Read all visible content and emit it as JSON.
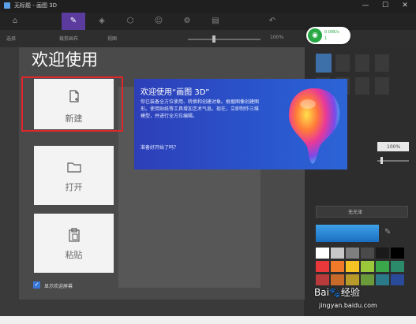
{
  "window": {
    "title": "无标题 - 画图 3D",
    "minimize": "—",
    "maximize": "☐",
    "close": "✕"
  },
  "toolbar": {
    "tools": [
      "⌂",
      "✎",
      "◈",
      "⬡",
      "☺",
      "⚙",
      "▤",
      "↶"
    ]
  },
  "subbar": {
    "select": "选择",
    "crop": "裁剪画布",
    "view": "视图",
    "zoom_value": "100%"
  },
  "welcome": {
    "title": "欢迎使用",
    "cards": {
      "new": "新建",
      "open": "打开",
      "paste": "粘贴"
    },
    "show_on_start": "显示欢迎屏幕"
  },
  "banner": {
    "title": "欢迎使用“画图 3D”",
    "body": "你已装备全方位使用、转换和创建对象。根据图像创建图形。使用贴纸等工具增加艺术气息。现在，立即制作三维模型，并进行全方位编辑。",
    "ask": "准备好开始了吗？"
  },
  "net_widget": {
    "up": "0.00K/s",
    "down": "1"
  },
  "right_panel": {
    "opacity": "100%",
    "dropdown": "无光泽"
  },
  "watermark": {
    "text": "Bai🐾经验",
    "url": "jingyan.baidu.com"
  },
  "colors": {
    "accent": "#5b3b9e",
    "highlight_red": "#e0262a",
    "banner_blue": "#2d3fb8"
  }
}
